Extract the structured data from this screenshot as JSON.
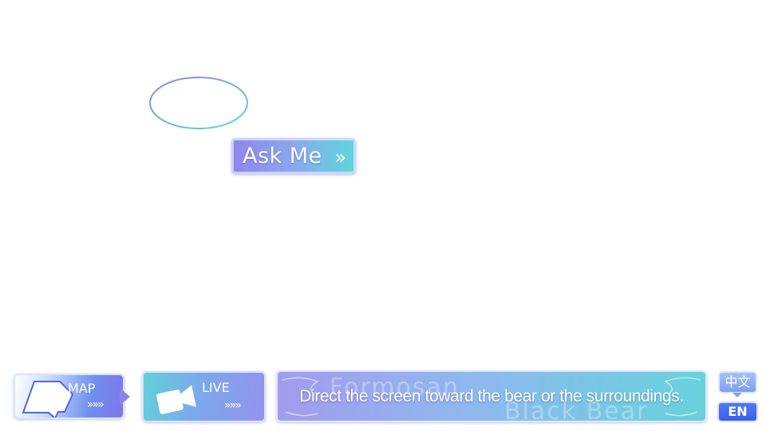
{
  "ask": {
    "label": "Ask Me",
    "chevron": "»"
  },
  "map_button": {
    "label": "MAP",
    "chevrons": "»»»",
    "icon": "map-shape-icon"
  },
  "live_button": {
    "label": "LIVE",
    "chevrons": "»»»",
    "icon": "camera-icon"
  },
  "message": {
    "text": "Direct the screen toward the bear or the surroundings.",
    "watermark_line1": "Formosan",
    "watermark_line2": "Black Bear"
  },
  "language": {
    "zh_label": "中文",
    "en_label": "EN",
    "selected": "EN"
  },
  "colors": {
    "accent_blue": "#4f7bf2",
    "accent_purple": "#8f86ec",
    "accent_teal": "#5fd6dc"
  }
}
